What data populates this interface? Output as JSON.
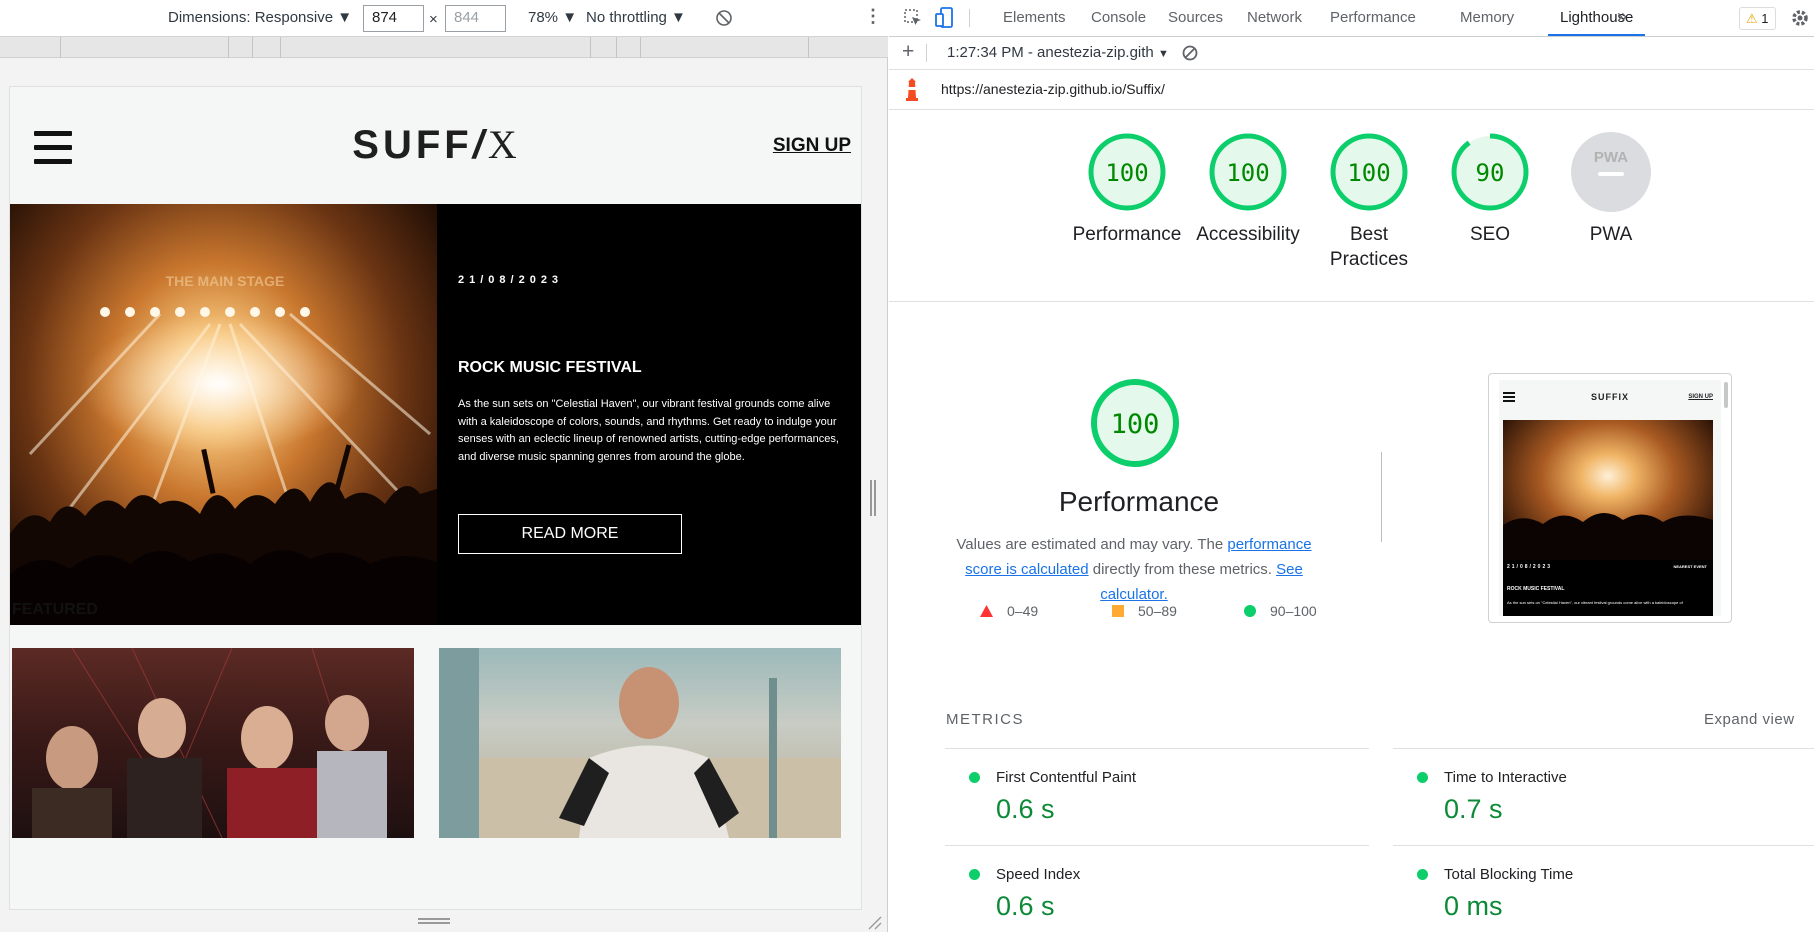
{
  "device_toolbar": {
    "dimensions_label": "Dimensions: Responsive",
    "width_value": "874",
    "height_placeholder": "844",
    "times": "×",
    "zoom": "78%",
    "throttling": "No throttling"
  },
  "site": {
    "logo_main": "SUFF",
    "logo_i": "/",
    "logo_x": "X",
    "signup": "SIGN UP",
    "hero": {
      "date": "21/08/2023",
      "title": "ROCK MUSIC FESTIVAL",
      "body": "As the sun sets on \"Celestial Haven\", our vibrant festival grounds come alive with a kaleidoscope of colors, sounds, and rhythms. Get ready to indulge your senses with an eclectic lineup of renowned artists, cutting-edge performances, and diverse music spanning genres from around the globe.",
      "button": "READ MORE",
      "stage_sign": "THE MAIN STAGE"
    },
    "featured_heading": "FEATURED"
  },
  "devtools": {
    "tabs": [
      "Elements",
      "Console",
      "Sources",
      "Network",
      "Performance",
      "Memory",
      "Lighthouse"
    ],
    "active_tab": "Lighthouse",
    "more_tabs": "»",
    "warnings_count": "1",
    "report_time": "1:27:34 PM - anestezia-zip.gith",
    "url": "https://anestezia-zip.github.io/Suffix/"
  },
  "lighthouse": {
    "gauges": [
      {
        "score": "100",
        "value": 100,
        "label": "Performance"
      },
      {
        "score": "100",
        "value": 100,
        "label": "Accessibility"
      },
      {
        "score": "100",
        "value": 100,
        "label": "Best Practices"
      },
      {
        "score": "90",
        "value": 90,
        "label": "SEO"
      },
      {
        "score": "",
        "value": 0,
        "label": "PWA",
        "badge": "PWA"
      }
    ],
    "perf_score": "100",
    "perf_title": "Performance",
    "perf_desc_1": "Values are estimated and may vary. The ",
    "perf_desc_link1": "performance score is calculated",
    "perf_desc_2": " directly from these metrics. ",
    "perf_desc_link2": "See calculator.",
    "legend": [
      {
        "range": "0–49",
        "shape": "triangle",
        "color": "#ff3333"
      },
      {
        "range": "50–89",
        "shape": "square",
        "color": "#ffaa33"
      },
      {
        "range": "90–100",
        "shape": "circle",
        "color": "#0cce6b"
      }
    ],
    "thumbnail": {
      "logo": "SUFFIX",
      "signup": "SIGN UP",
      "date": "21/08/2023",
      "tag": "NEAREST EVENT",
      "title": "ROCK MUSIC FESTIVAL",
      "body": "As the sun sets on \"Celestial Haven\", our vibrant festival grounds come alive with a kaleidoscope of"
    },
    "metrics_title": "METRICS",
    "expand_view": "Expand view",
    "metrics": [
      {
        "name": "First Contentful Paint",
        "value": "0.6 s"
      },
      {
        "name": "Time to Interactive",
        "value": "0.7 s"
      },
      {
        "name": "Speed Index",
        "value": "0.6 s"
      },
      {
        "name": "Total Blocking Time",
        "value": "0 ms"
      }
    ]
  },
  "colors": {
    "pass_green": "#0cce6b",
    "pass_text": "#008800",
    "pass_fill": "#e5f8ec",
    "link_blue": "#1a73e8",
    "active_tab_underline": "#1a73e8"
  }
}
